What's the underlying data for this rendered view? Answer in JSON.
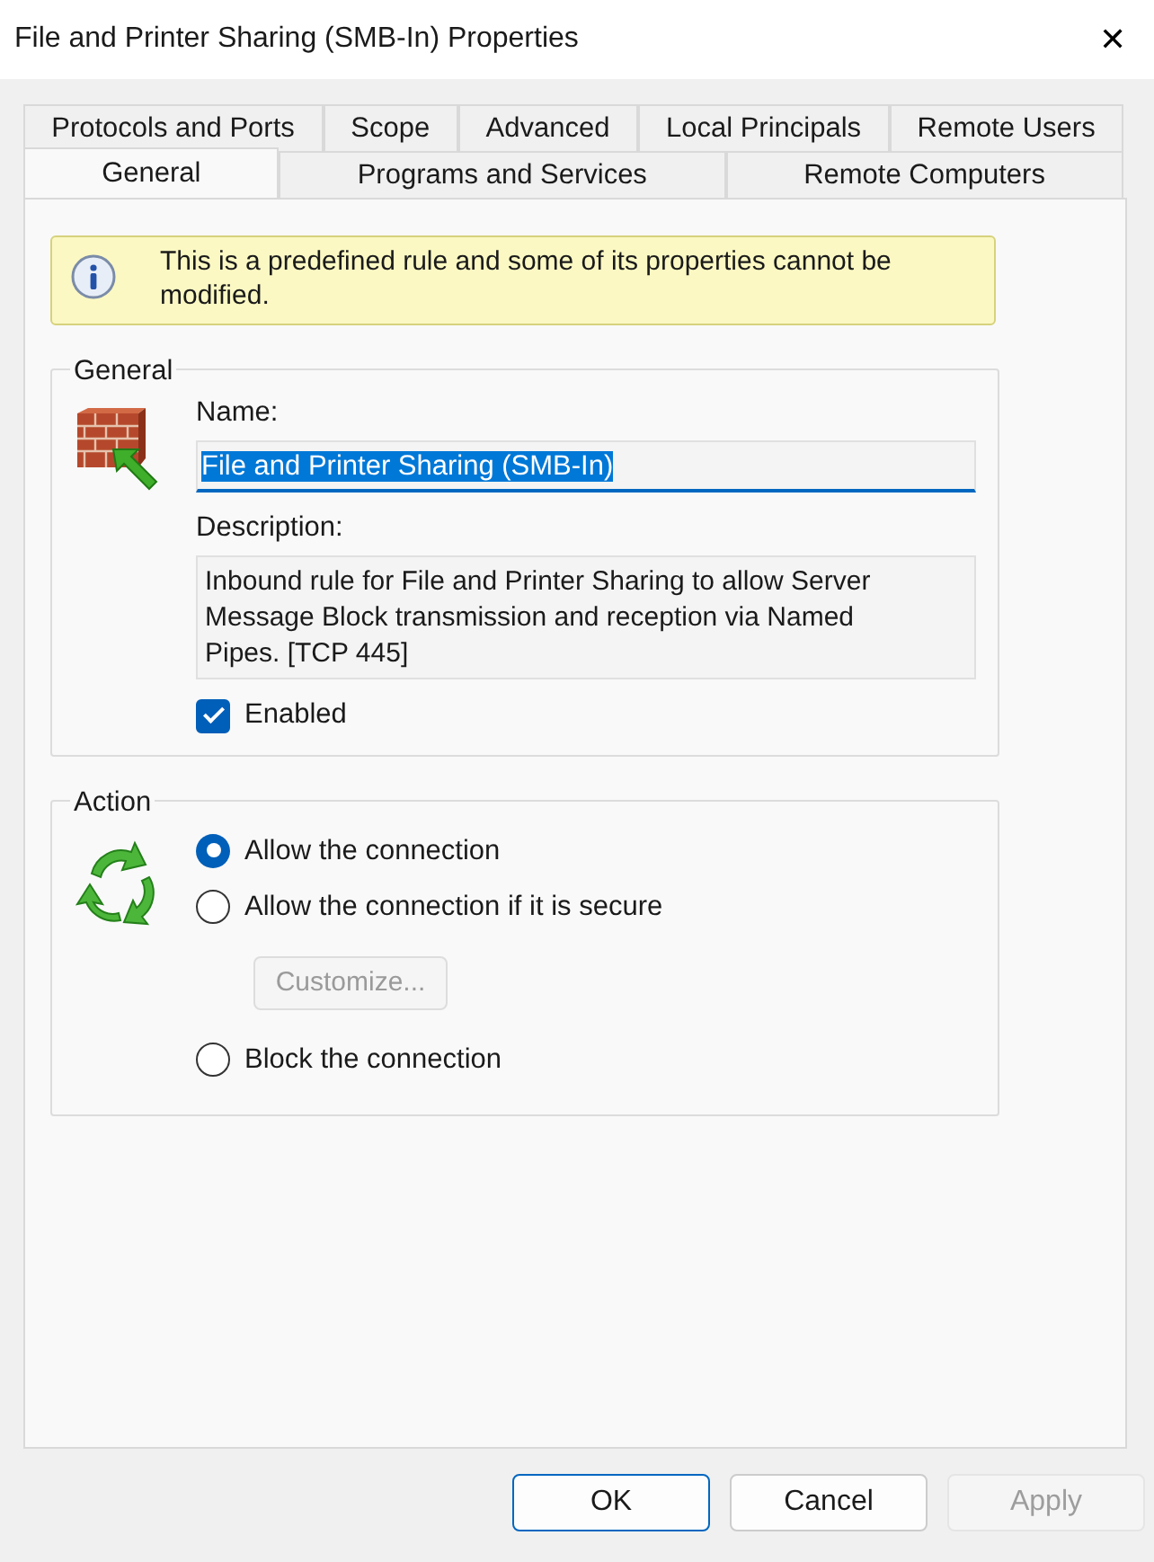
{
  "window": {
    "title": "File and Printer Sharing (SMB-In) Properties",
    "close": "✕"
  },
  "tab_rows": [
    [
      {
        "label": "Protocols and Ports",
        "selected": false
      },
      {
        "label": "Scope",
        "selected": false
      },
      {
        "label": "Advanced",
        "selected": false
      },
      {
        "label": "Local Principals",
        "selected": false
      },
      {
        "label": "Remote Users",
        "selected": false
      }
    ],
    [
      {
        "label": "General",
        "selected": true
      },
      {
        "label": "Programs and Services",
        "selected": false
      },
      {
        "label": "Remote Computers",
        "selected": false
      }
    ]
  ],
  "info_banner": "This is a predefined rule and some of its properties cannot be modified.",
  "general": {
    "legend": "General",
    "name_label": "Name:",
    "name_value": "File and Printer Sharing (SMB-In)",
    "description_label": "Description:",
    "description": "Inbound rule for File and Printer Sharing to allow Server Message Block transmission and reception via Named Pipes. [TCP 445]",
    "enabled": {
      "label": "Enabled",
      "checked": true
    }
  },
  "action": {
    "legend": "Action",
    "options": [
      {
        "label": "Allow the connection",
        "selected": true
      },
      {
        "label": "Allow the connection if it is secure",
        "selected": false,
        "sub_button": {
          "label": "Customize...",
          "disabled": true
        }
      },
      {
        "label": "Block the connection",
        "selected": false
      }
    ]
  },
  "buttons": [
    {
      "label": "OK",
      "kind": "default",
      "disabled": false
    },
    {
      "label": "Cancel",
      "kind": "normal",
      "disabled": false
    },
    {
      "label": "Apply",
      "kind": "normal",
      "disabled": true
    }
  ]
}
